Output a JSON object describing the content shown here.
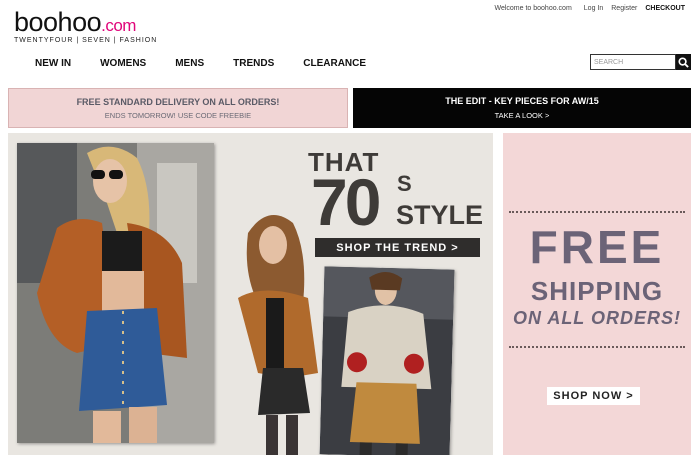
{
  "header": {
    "logo_brand": "boohoo",
    "logo_domain": ".com",
    "tagline": "TWENTYFOUR | SEVEN | FASHION",
    "welcome": "Welcome to boohoo.com",
    "login": "Log In",
    "register": "Register",
    "checkout": "CHECKOUT"
  },
  "nav": [
    "NEW IN",
    "WOMENS",
    "MENS",
    "TRENDS",
    "CLEARANCE"
  ],
  "search": {
    "placeholder": "SEARCH",
    "icon": "search-icon"
  },
  "promo_delivery": {
    "title": "FREE STANDARD DELIVERY ON ALL ORDERS!",
    "subtitle": "ENDS TOMORROW! USE CODE FREEBIE"
  },
  "promo_edit": {
    "title": "THE EDIT - KEY PIECES FOR AW/15",
    "subtitle": "TAKE A LOOK >"
  },
  "hero": {
    "that": "THAT",
    "seventy": "70",
    "s": "S",
    "style": "STYLE",
    "cta": "SHOP THE TREND >"
  },
  "shipping_banner": {
    "free": "FREE",
    "shipping": "SHIPPING",
    "all_orders": "ON ALL ORDERS!",
    "cta": "SHOP NOW >"
  },
  "colors": {
    "brand_pink": "#e0057a",
    "promo_pink": "#f1d5d5",
    "promo_black": "#050505",
    "banner_text": "#6b6377"
  }
}
